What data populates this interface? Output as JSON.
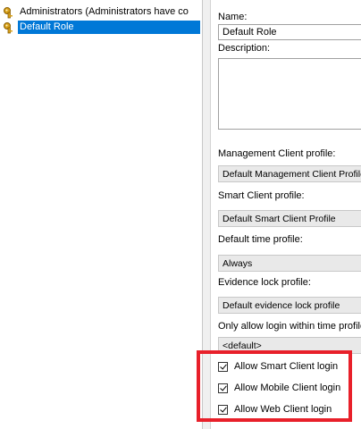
{
  "tree": {
    "items": [
      {
        "label": "Administrators (Administrators have co",
        "selected": false,
        "icon": "role-key-icon"
      },
      {
        "label": "Default Role",
        "selected": true,
        "icon": "role-key-icon"
      }
    ]
  },
  "form": {
    "name_label": "Name:",
    "name_value": "Default Role",
    "description_label": "Description:",
    "description_value": "",
    "management_profile_label": "Management Client profile:",
    "management_profile_value": "Default Management Client Profile",
    "smart_client_profile_label": "Smart Client profile:",
    "smart_client_profile_value": "Default Smart Client Profile",
    "default_time_profile_label": "Default time profile:",
    "default_time_profile_value": "Always",
    "evidence_lock_label": "Evidence lock profile:",
    "evidence_lock_value": "Default evidence lock profile",
    "login_time_profile_label": "Only allow login within time profile:",
    "login_time_profile_value": "<default>"
  },
  "checkboxes": [
    {
      "label": "Allow Smart Client login",
      "checked": true
    },
    {
      "label": "Allow Mobile Client login",
      "checked": true
    },
    {
      "label": "Allow Web Client login",
      "checked": true
    }
  ],
  "colors": {
    "selection": "#0078d7",
    "highlight_border": "#e8202a",
    "combo_bg": "#e9e9e9"
  }
}
